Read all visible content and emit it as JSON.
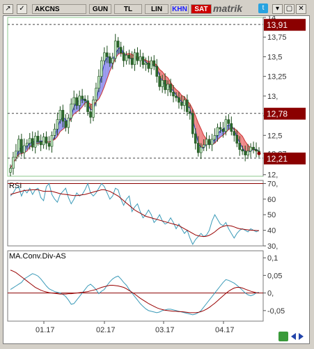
{
  "toolbar": {
    "symbol": "AKCNS",
    "period": "GUN",
    "currency": "TL",
    "scale": "LIN",
    "khn_label": "KHN",
    "sat_label": "SAT",
    "brand": "matrik",
    "close_glyph": "✕",
    "restore_glyph": "▢",
    "pin_glyph": "▾",
    "tb_colors": {
      "khn": "#1a1aff",
      "sat_bg": "#cc0000"
    }
  },
  "chart_data": [
    {
      "type": "candlestick",
      "title": "",
      "x": [
        "01.17",
        "02.17",
        "03.17",
        "04.17"
      ],
      "yticks": [
        "14,",
        "13,75",
        "13,5",
        "13,25",
        "13,",
        "12,75",
        "12,5",
        "12,27",
        "12,"
      ],
      "ylim": [
        11.98,
        14.0
      ],
      "reference_lines": [
        13.91,
        12.78,
        12.21
      ],
      "price_tags": [
        "13,91",
        "12,78",
        "12,21"
      ],
      "last_price": 12.27,
      "overlays": [
        {
          "name": "",
          "color": "#3333cc",
          "fill": "#9999ee"
        },
        {
          "name": "",
          "color": "#cc3333",
          "fill": "#ee8888"
        }
      ],
      "closes": [
        12.08,
        12.22,
        12.3,
        12.45,
        12.28,
        12.37,
        12.4,
        12.46,
        12.35,
        12.49,
        12.42,
        12.38,
        12.48,
        12.4,
        12.36,
        12.5,
        12.58,
        12.7,
        12.82,
        12.68,
        12.6,
        12.72,
        12.9,
        12.98,
        12.88,
        13.0,
        12.96,
        12.94,
        12.8,
        12.73,
        12.95,
        13.1,
        13.25,
        13.45,
        13.55,
        13.5,
        13.42,
        13.48,
        13.7,
        13.62,
        13.55,
        13.45,
        13.52,
        13.48,
        13.4,
        13.55,
        13.45,
        13.5,
        13.4,
        13.42,
        13.35,
        13.45,
        13.38,
        13.25,
        13.12,
        13.2,
        13.08,
        13.15,
        13.05,
        13.0,
        12.98,
        12.92,
        12.88,
        12.95,
        12.8,
        12.78,
        12.52,
        12.4,
        12.28,
        12.35,
        12.38,
        12.45,
        12.38,
        12.45,
        12.5,
        12.6,
        12.58,
        12.55,
        12.7,
        12.65,
        12.55,
        12.5,
        12.4,
        12.32,
        12.3,
        12.25,
        12.3,
        12.35,
        12.32,
        12.3,
        12.27
      ]
    },
    {
      "type": "line",
      "title": "RSI",
      "x": [
        "01.17",
        "02.17",
        "03.17",
        "04.17"
      ],
      "yticks": [
        "70,",
        "60",
        "50",
        "40",
        "30,"
      ],
      "ylim": [
        30,
        72
      ],
      "reference_line": 70,
      "series": [
        {
          "name": "",
          "color": "#3a9ab8",
          "values": [
            62,
            64,
            67,
            68,
            62,
            66,
            64,
            67,
            63,
            66,
            67,
            61,
            59,
            68,
            70,
            63,
            60,
            58,
            63,
            65,
            67,
            61,
            57,
            60,
            64,
            62,
            63,
            66,
            70,
            64,
            62,
            64,
            67,
            70,
            68,
            64,
            60,
            62,
            67,
            66,
            60,
            56,
            60,
            62,
            52,
            55,
            57,
            52,
            48,
            50,
            53,
            50,
            45,
            47,
            50,
            46,
            44,
            45,
            48,
            45,
            41,
            44,
            41,
            38,
            40,
            35,
            31,
            34,
            36,
            38,
            36,
            37,
            40,
            46,
            50,
            47,
            44,
            43,
            45,
            41,
            38,
            35,
            38,
            40,
            41,
            40,
            39,
            41,
            40,
            39,
            40
          ]
        },
        {
          "name": "",
          "color": "#990000",
          "values": [
            63,
            63.5,
            64,
            64.5,
            65,
            65.5,
            65.7,
            65.8,
            66,
            66,
            66,
            65.5,
            65,
            65,
            65,
            65,
            64.5,
            64,
            63.5,
            63.2,
            63,
            62.8,
            62.5,
            62.3,
            62.3,
            62.5,
            62.8,
            63,
            63.5,
            64,
            64.5,
            65,
            65.5,
            66,
            66,
            65.5,
            65,
            64,
            63,
            62,
            60.5,
            59,
            57.5,
            56,
            54.5,
            53,
            52,
            51,
            50,
            49,
            48.5,
            48,
            47.5,
            47,
            46.5,
            46,
            45.5,
            45,
            44.5,
            44,
            43.5,
            43,
            42,
            41,
            40,
            39,
            38,
            37,
            36.5,
            36.2,
            36,
            36.2,
            36.8,
            37.8,
            39,
            40.5,
            41.8,
            42.5,
            43,
            43,
            42.8,
            42.2,
            41.5,
            41,
            40.8,
            40.5,
            40.3,
            40.1,
            40,
            39.9,
            39.8
          ]
        }
      ]
    },
    {
      "type": "line",
      "title": "MA.Conv.Div-AS",
      "x": [
        "01.17",
        "02.17",
        "03.17",
        "04.17"
      ],
      "yticks": [
        "0,1",
        "0,05",
        "0,",
        "-0,05"
      ],
      "ylim": [
        -0.08,
        0.12
      ],
      "reference_line": 0,
      "series": [
        {
          "name": "",
          "color": "#3a9ab8",
          "values": [
            0.01,
            0.015,
            0.02,
            0.025,
            0.03,
            0.04,
            0.045,
            0.05,
            0.055,
            0.052,
            0.048,
            0.04,
            0.03,
            0.02,
            0.012,
            0.008,
            0.004,
            0.002,
            0.0,
            -0.004,
            -0.01,
            -0.02,
            -0.032,
            -0.03,
            -0.02,
            -0.01,
            0.0,
            0.01,
            0.02,
            0.025,
            0.018,
            0.01,
            -0.002,
            0.005,
            0.01,
            0.022,
            0.032,
            0.04,
            0.045,
            0.048,
            0.04,
            0.03,
            0.022,
            0.01,
            0.0,
            -0.01,
            -0.02,
            -0.03,
            -0.038,
            -0.045,
            -0.05,
            -0.052,
            -0.054,
            -0.056,
            -0.054,
            -0.05,
            -0.048,
            -0.046,
            -0.046,
            -0.048,
            -0.05,
            -0.052,
            -0.054,
            -0.056,
            -0.058,
            -0.06,
            -0.062,
            -0.06,
            -0.056,
            -0.05,
            -0.04,
            -0.03,
            -0.02,
            -0.01,
            0.0,
            0.01,
            0.02,
            0.03,
            0.038,
            0.036,
            0.032,
            0.028,
            0.022,
            0.015,
            0.008,
            0.0,
            -0.005,
            -0.008,
            -0.005,
            0.0,
            0.002
          ]
        },
        {
          "name": "",
          "color": "#990000",
          "values": [
            0.065,
            0.062,
            0.058,
            0.052,
            0.046,
            0.04,
            0.034,
            0.028,
            0.022,
            0.016,
            0.012,
            0.008,
            0.005,
            0.003,
            0.001,
            0.0,
            -0.001,
            -0.002,
            -0.003,
            -0.003,
            -0.003,
            -0.002,
            -0.002,
            -0.001,
            0.0,
            0.001,
            0.002,
            0.003,
            0.004,
            0.006,
            0.008,
            0.01,
            0.013,
            0.016,
            0.018,
            0.02,
            0.022,
            0.022,
            0.021,
            0.02,
            0.018,
            0.016,
            0.012,
            0.007,
            0.002,
            -0.003,
            -0.009,
            -0.015,
            -0.02,
            -0.025,
            -0.03,
            -0.034,
            -0.038,
            -0.042,
            -0.045,
            -0.047,
            -0.049,
            -0.05,
            -0.051,
            -0.052,
            -0.052,
            -0.053,
            -0.053,
            -0.054,
            -0.055,
            -0.056,
            -0.056,
            -0.056,
            -0.055,
            -0.053,
            -0.05,
            -0.046,
            -0.041,
            -0.035,
            -0.029,
            -0.022,
            -0.015,
            -0.008,
            -0.001,
            0.005,
            0.01,
            0.014,
            0.016,
            0.016,
            0.014,
            0.011,
            0.008,
            0.005,
            0.003,
            0.001,
            0.0
          ]
        }
      ]
    }
  ]
}
